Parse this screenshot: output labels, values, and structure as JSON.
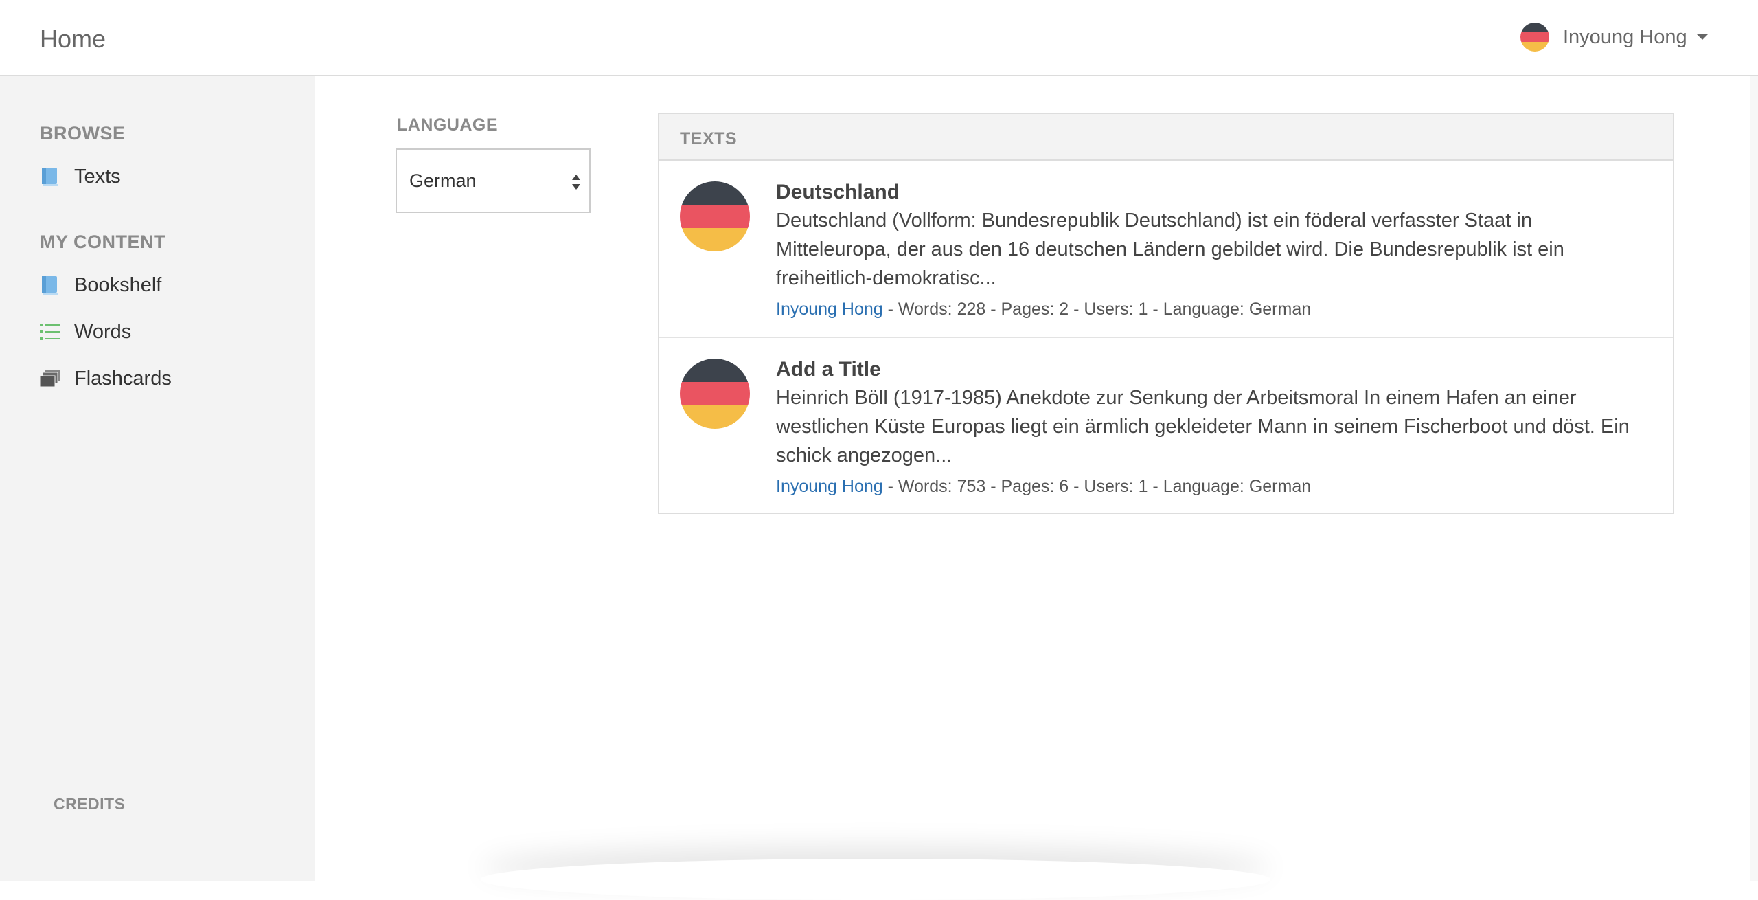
{
  "header": {
    "home_label": "Home",
    "user_name": "Inyoung Hong",
    "user_flag_icon": "germany-flag-icon"
  },
  "sidebar": {
    "browse_title": "BROWSE",
    "browse_items": [
      {
        "label": "Texts",
        "icon": "book-icon"
      }
    ],
    "my_content_title": "MY CONTENT",
    "my_content_items": [
      {
        "label": "Bookshelf",
        "icon": "book-icon"
      },
      {
        "label": "Words",
        "icon": "list-icon"
      },
      {
        "label": "Flashcards",
        "icon": "cards-icon"
      }
    ],
    "credits_label": "CREDITS"
  },
  "filter": {
    "language_label": "LANGUAGE",
    "language_value": "German"
  },
  "texts": {
    "header": "TEXTS",
    "items": [
      {
        "title": "Deutschland",
        "excerpt": "Deutschland (Vollform: Bundesrepublik Deutschland) ist ein föderal verfasster Staat in Mitteleuropa, der aus den 16 deutschen Ländern gebildet wird. Die Bundesrepublik ist ein freiheitlich-demokratisc...",
        "author": "Inyoung Hong",
        "meta": " - Words: 228 - Pages: 2 - Users: 1 - Language: German",
        "flag_icon": "germany-flag-icon"
      },
      {
        "title": "Add a Title",
        "excerpt": "Heinrich Böll (1917-1985) Anekdote zur Senkung der Arbeitsmoral In einem Hafen an einer westlichen Küste Europas liegt ein ärmlich gekleideter Mann in seinem Fischerboot und döst. Ein schick angezogen...",
        "author": "Inyoung Hong",
        "meta": " - Words: 753 - Pages: 6 - Users: 1 - Language: German",
        "flag_icon": "germany-flag-icon"
      }
    ]
  },
  "colors": {
    "flag_black": "#3d434c",
    "flag_red": "#ea5461",
    "flag_gold": "#f5bd47",
    "link_blue": "#2a6fb1",
    "sidebar_bg": "#f3f3f3",
    "book_icon_blue": "#7ab8e8",
    "list_icon_green": "#6cc070",
    "cards_icon_gray": "#555555"
  }
}
